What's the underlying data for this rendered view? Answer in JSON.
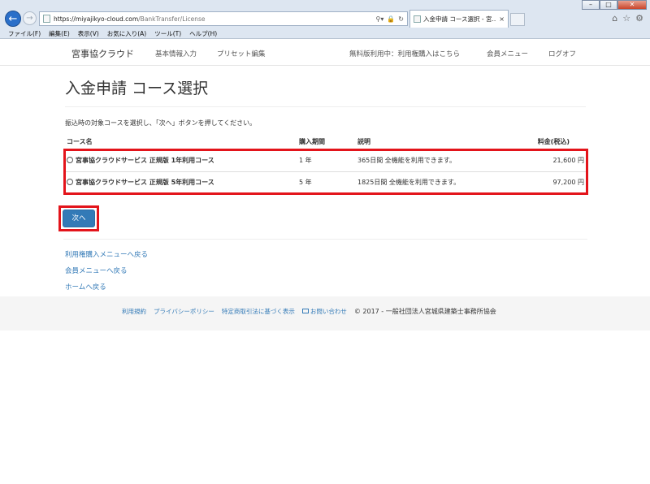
{
  "browser": {
    "url_host": "https://miyajikyo-cloud.com",
    "url_path": "/BankTransfer/License",
    "tab_title": "入金申請 コース選択 - 宮...",
    "tab_close": "×",
    "menu": [
      "ファイル(F)",
      "編集(E)",
      "表示(V)",
      "お気に入り(A)",
      "ツール(T)",
      "ヘルプ(H)"
    ],
    "win_minimize": "–",
    "win_maximize": "□",
    "win_close": "✕"
  },
  "site_nav": {
    "brand": "宮事協クラウド",
    "basic_info": "基本情報入力",
    "preset_edit": "プリセット編集",
    "trial_notice": "無料版利用中：利用権購入はこちら",
    "member_menu": "会員メニュー",
    "logout": "ログオフ"
  },
  "page": {
    "title": "入金申請 コース選択",
    "instruction": "振込時の対象コースを選択し、「次へ」ボタンを押してください。"
  },
  "table": {
    "headers": {
      "course": "コース名",
      "period": "購入期間",
      "description": "説明",
      "price": "料金(税込)"
    },
    "rows": [
      {
        "course": "宮事協クラウドサービス 正規版 1年利用コース",
        "period": "1 年",
        "description": "365日間 全機能を利用できます。",
        "price": "21,600 円",
        "selected": false
      },
      {
        "course": "宮事協クラウドサービス 正規版 5年利用コース",
        "period": "5 年",
        "description": "1825日間 全機能を利用できます。",
        "price": "97,200 円",
        "selected": false
      }
    ]
  },
  "next_button": "次へ",
  "links": {
    "license_menu": "利用権購入メニューへ戻る",
    "member_menu": "会員メニューへ戻る",
    "home": "ホームへ戻る"
  },
  "footer": {
    "terms": "利用規約",
    "privacy": "プライバシーポリシー",
    "commerce_law": "特定商取引法に基づく表示",
    "contact": "お問い合わせ",
    "copyright": "© 2017 - 一般社団法人宮城県建築士事務所協会"
  },
  "colors": {
    "link": "#337ab7",
    "primary_button": "#337ab7",
    "highlight_box": "#e3141b",
    "ie_back_button": "#2a6fc9"
  }
}
